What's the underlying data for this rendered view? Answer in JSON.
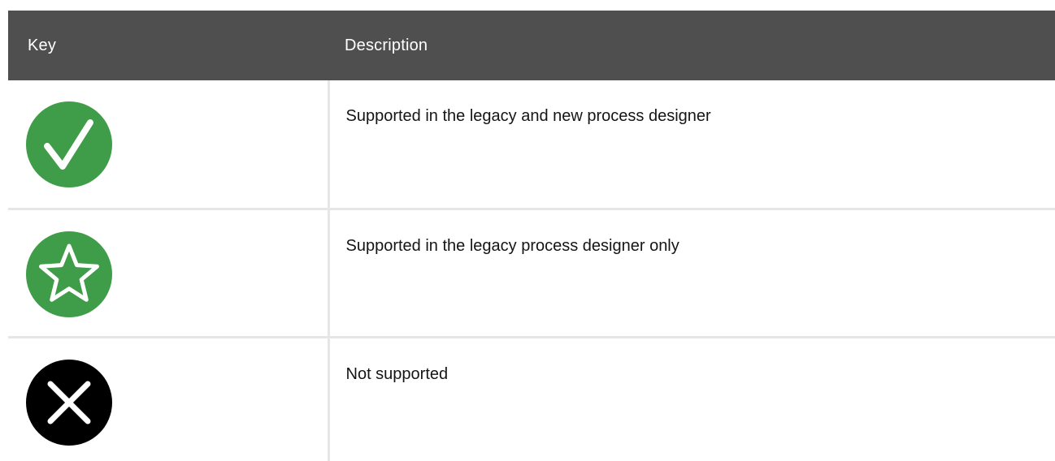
{
  "table": {
    "headers": {
      "key": "Key",
      "description": "Description"
    },
    "rows": [
      {
        "icon": "check-circle-icon",
        "icon_color": "#3f9c48",
        "description": "Supported in the legacy and new process designer"
      },
      {
        "icon": "star-circle-icon",
        "icon_color": "#3f9c48",
        "description": "Supported in the legacy process designer only"
      },
      {
        "icon": "x-circle-icon",
        "icon_color": "#000000",
        "description": "Not supported"
      }
    ]
  },
  "colors": {
    "header_background": "#4f4f4f",
    "header_text": "#ffffff",
    "body_text": "#151515",
    "border": "#e6e6e6"
  }
}
